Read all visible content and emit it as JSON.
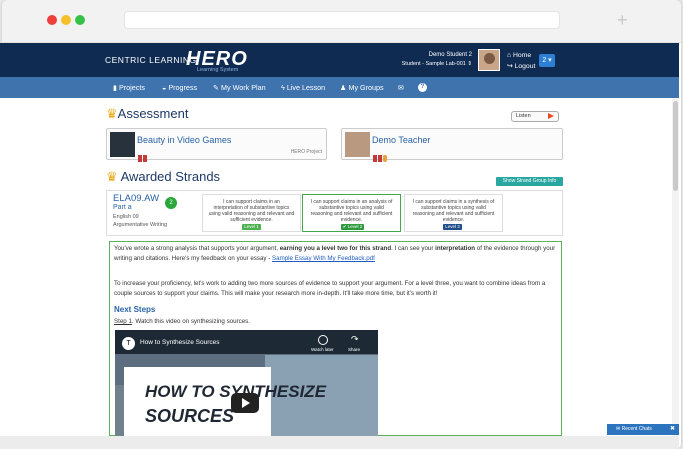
{
  "browser": {
    "new_tab_glyph": "+"
  },
  "brand": {
    "name": "CENTRIC LEARNING",
    "hero": "HERO",
    "hero_sub": "Learning System"
  },
  "user": {
    "name": "Demo Student 2",
    "section": "Student - Sample Lab-001 ⇕"
  },
  "top_links": {
    "home": "Home",
    "logout": "Logout",
    "menu_value": "2"
  },
  "nav": {
    "projects": "Projects",
    "progress": "Progress",
    "workplan": "My Work Plan",
    "live": "Live Lesson",
    "groups": "My Groups"
  },
  "assessment": {
    "title": "Assessment",
    "listen": "Listen"
  },
  "project_card": {
    "title": "Beauty in Video Games",
    "tag": "HERO Project"
  },
  "teacher_card": {
    "title": "Demo Teacher"
  },
  "strands": {
    "title": "Awarded Strands",
    "info_button": "Show Strand Group Info"
  },
  "strand": {
    "code": "ELA09.AW",
    "part": "Part a",
    "course": "English 09",
    "category": "Argumentative Writing",
    "awarded": "2",
    "levels": [
      {
        "text": "I can support claims in an interpretation of substantive topics using valid reasoning and relevant and sufficient evidence.",
        "label": "Level 1",
        "color": "#4caf50"
      },
      {
        "text": "I can support claims in an analysis of substantive topics using valid reasoning and relevant and sufficient evidence.",
        "label": "✔ Level 2",
        "color": "#2e9a3e"
      },
      {
        "text": "I can support claims in a synthesis of substantive topics using valid reasoning and relevant and sufficient evidence.",
        "label": "Level 3",
        "color": "#1f4f8a"
      }
    ]
  },
  "feedback": {
    "p1a": "You've wrote a strong analysis that supports your argument, ",
    "p1b": "earning you a level two for this strand",
    "p1c": ". I can see your ",
    "p1d": "interpretation",
    "p1e": " of the evidence through your writing and citations. Here's my feedback on your essay - ",
    "link": "Sample Essay With My Feedback.pdf",
    "p2": "To increase your proficiency, let's work to adding two more sources of evidence to support your argument. For a level three, you want to combine ideas from a couple sources to support your claims. This will make your research more in-depth. It'll take more time, but it's worth it!",
    "next_steps": "Next Steps",
    "step_label": "Step 1",
    "step_text": ". Watch this video on synthesizing sources."
  },
  "video": {
    "title": "How to Synthesize Sources",
    "watch_later": "Watch later",
    "share": "Share",
    "big1": "HOW TO SYNTHESIZE",
    "big2": "SOURCES",
    "logo": "T"
  },
  "chat": {
    "label": "Recent Chats",
    "close": "✖"
  }
}
